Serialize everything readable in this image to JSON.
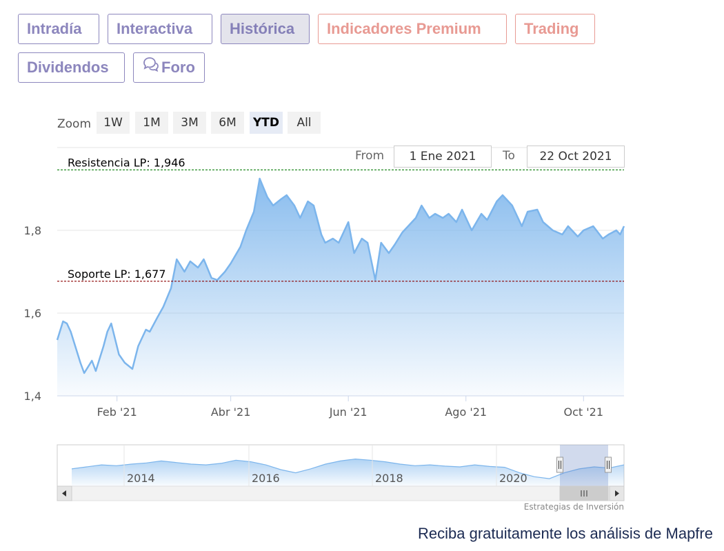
{
  "tabs": [
    {
      "label": "Intradía",
      "style": "normal"
    },
    {
      "label": "Interactiva",
      "style": "normal"
    },
    {
      "label": "Histórica",
      "style": "active"
    },
    {
      "label": "Indicadores Premium",
      "style": "premium"
    },
    {
      "label": "Trading",
      "style": "premium"
    },
    {
      "label": "Dividendos",
      "style": "normal"
    },
    {
      "label": "Foro",
      "style": "normal",
      "icon": "speech-bubbles-icon"
    }
  ],
  "zoom": {
    "label": "Zoom",
    "buttons": [
      "1W",
      "1M",
      "3M",
      "6M",
      "YTD",
      "All"
    ],
    "selected": "YTD"
  },
  "range": {
    "from_label": "From",
    "from_value": "1 Ene 2021",
    "to_label": "To",
    "to_value": "22 Oct 2021"
  },
  "colors": {
    "accent": "#8c86bd",
    "premium": "#e89a93",
    "series_line": "#7cb5ec",
    "resistance": "#228b22",
    "support": "#8b0000"
  },
  "chart_data": {
    "type": "area",
    "x_start": "2021-01-01",
    "x_end": "2021-10-22",
    "x_ticks": [
      {
        "label": "Feb '21",
        "date": "2021-02-01"
      },
      {
        "label": "Abr '21",
        "date": "2021-04-01"
      },
      {
        "label": "Jun '21",
        "date": "2021-06-01"
      },
      {
        "label": "Ago '21",
        "date": "2021-08-01"
      },
      {
        "label": "Oct '21",
        "date": "2021-10-01"
      }
    ],
    "y_ticks": [
      {
        "label": "1,4",
        "value": 1.4
      },
      {
        "label": "1,6",
        "value": 1.6
      },
      {
        "label": "1,8",
        "value": 1.8
      }
    ],
    "ylim": [
      1.4,
      2.0
    ],
    "grid": true,
    "annotations": [
      {
        "label": "Resistencia LP: 1,946",
        "value": 1.946,
        "style": "dashed",
        "color": "#228b22"
      },
      {
        "label": "Soporte LP: 1,677",
        "value": 1.677,
        "style": "dashed",
        "color": "#8b0000"
      }
    ],
    "series": [
      {
        "x": [
          "2021-01-01",
          "2021-01-04",
          "2021-01-06",
          "2021-01-08",
          "2021-01-11",
          "2021-01-13",
          "2021-01-15",
          "2021-01-19",
          "2021-01-21",
          "2021-01-25",
          "2021-01-27",
          "2021-01-29",
          "2021-02-02",
          "2021-02-05",
          "2021-02-09",
          "2021-02-12",
          "2021-02-16",
          "2021-02-18",
          "2021-02-22",
          "2021-02-25",
          "2021-03-01",
          "2021-03-04",
          "2021-03-08",
          "2021-03-11",
          "2021-03-15",
          "2021-03-18",
          "2021-03-22",
          "2021-03-25",
          "2021-03-29",
          "2021-04-01",
          "2021-04-06",
          "2021-04-09",
          "2021-04-13",
          "2021-04-16",
          "2021-04-20",
          "2021-04-23",
          "2021-04-27",
          "2021-04-30",
          "2021-05-04",
          "2021-05-07",
          "2021-05-11",
          "2021-05-14",
          "2021-05-18",
          "2021-05-20",
          "2021-05-24",
          "2021-05-27",
          "2021-06-01",
          "2021-06-04",
          "2021-06-08",
          "2021-06-11",
          "2021-06-15",
          "2021-06-18",
          "2021-06-22",
          "2021-06-25",
          "2021-06-29",
          "2021-07-02",
          "2021-07-06",
          "2021-07-09",
          "2021-07-13",
          "2021-07-16",
          "2021-07-20",
          "2021-07-23",
          "2021-07-27",
          "2021-07-30",
          "2021-08-04",
          "2021-08-09",
          "2021-08-12",
          "2021-08-17",
          "2021-08-20",
          "2021-08-25",
          "2021-08-30",
          "2021-09-02",
          "2021-09-07",
          "2021-09-10",
          "2021-09-15",
          "2021-09-20",
          "2021-09-23",
          "2021-09-28",
          "2021-10-01",
          "2021-10-06",
          "2021-10-11",
          "2021-10-14",
          "2021-10-18",
          "2021-10-20",
          "2021-10-22"
        ],
        "y": [
          1.535,
          1.58,
          1.575,
          1.555,
          1.51,
          1.48,
          1.455,
          1.485,
          1.46,
          1.52,
          1.555,
          1.575,
          1.5,
          1.48,
          1.465,
          1.52,
          1.56,
          1.555,
          1.59,
          1.615,
          1.66,
          1.73,
          1.7,
          1.725,
          1.71,
          1.73,
          1.685,
          1.68,
          1.7,
          1.72,
          1.76,
          1.8,
          1.845,
          1.925,
          1.88,
          1.86,
          1.875,
          1.885,
          1.86,
          1.83,
          1.87,
          1.86,
          1.79,
          1.77,
          1.78,
          1.77,
          1.82,
          1.745,
          1.78,
          1.77,
          1.68,
          1.77,
          1.745,
          1.765,
          1.795,
          1.81,
          1.83,
          1.86,
          1.83,
          1.84,
          1.83,
          1.84,
          1.82,
          1.85,
          1.8,
          1.84,
          1.825,
          1.87,
          1.885,
          1.86,
          1.81,
          1.845,
          1.85,
          1.82,
          1.8,
          1.79,
          1.81,
          1.785,
          1.8,
          1.81,
          1.78,
          1.79,
          1.8,
          1.79,
          1.81
        ]
      }
    ],
    "navigator": {
      "x_ticks": [
        "2014",
        "2016",
        "2018",
        "2020"
      ],
      "y": [
        1.5,
        1.55,
        1.6,
        1.58,
        1.62,
        1.65,
        1.7,
        1.66,
        1.62,
        1.6,
        1.64,
        1.72,
        1.68,
        1.6,
        1.48,
        1.4,
        1.5,
        1.62,
        1.7,
        1.75,
        1.72,
        1.68,
        1.62,
        1.58,
        1.6,
        1.57,
        1.55,
        1.6,
        1.56,
        1.54,
        1.4,
        1.3,
        1.25,
        1.4,
        1.5,
        1.55,
        1.52,
        1.6
      ]
    }
  },
  "credits": "Estrategias de Inversión",
  "promo": "Reciba gratuitamente los análisis de Mapfre"
}
